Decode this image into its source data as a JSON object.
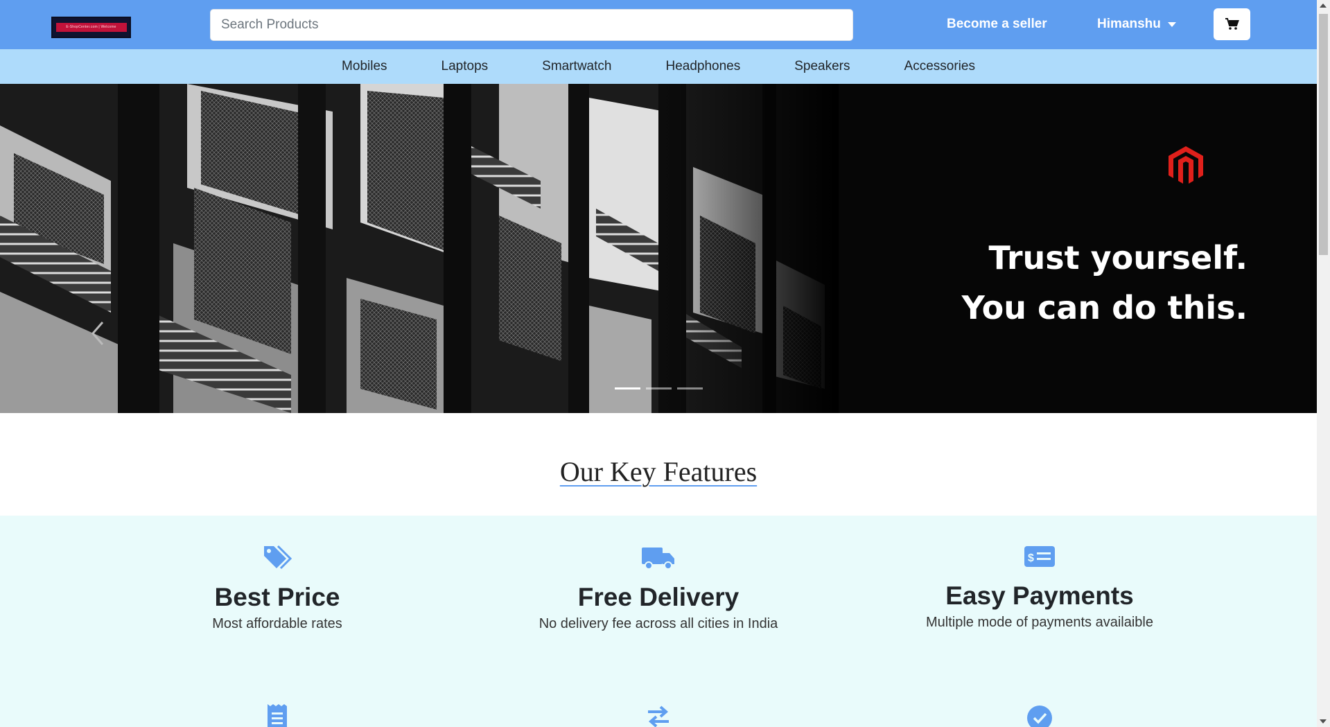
{
  "header": {
    "logo_text": "E-ShopCenter.com  |  Welcome",
    "search_placeholder": "Search Products",
    "seller_label": "Become a seller",
    "user_name": "Himanshu",
    "cart_icon": "cart-icon"
  },
  "categories": [
    "Mobiles",
    "Laptops",
    "Smartwatch",
    "Headphones",
    "Speakers",
    "Accessories"
  ],
  "hero": {
    "line1": "Trust yourself.",
    "line2": "You can do this.",
    "brand_color": "#e0201b",
    "slides": 3,
    "active_slide": 1
  },
  "key_features": {
    "title": "Our Key Features",
    "items": [
      {
        "icon": "tags-icon",
        "title": "Best Price",
        "text": "Most affordable rates"
      },
      {
        "icon": "truck-icon",
        "title": "Free Delivery",
        "text": "No delivery fee across all cities in India"
      },
      {
        "icon": "money-card-icon",
        "title": "Easy Payments",
        "text": "Multiple mode of payments availaible"
      }
    ],
    "accent": "#5f9ef0"
  }
}
